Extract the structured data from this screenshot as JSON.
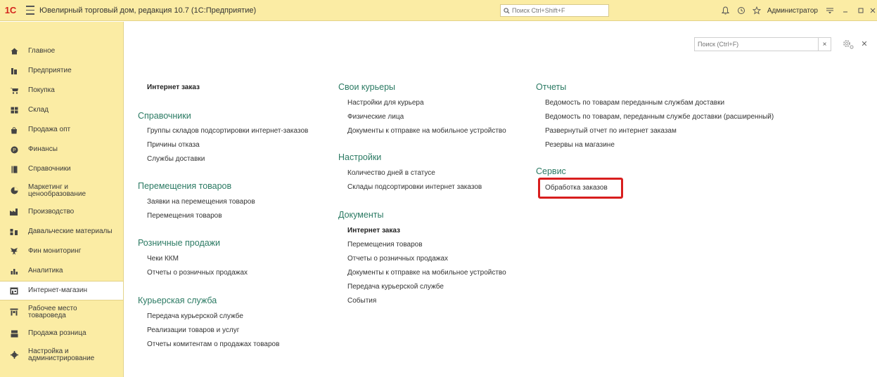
{
  "titlebar": {
    "logo": "1С",
    "title": "Ювелирный торговый дом, редакция 10.7  (1С:Предприятие)",
    "search_placeholder": "Поиск Ctrl+Shift+F",
    "user": "Администратор"
  },
  "sidebar": {
    "items": [
      {
        "label": "Главное"
      },
      {
        "label": "Предприятие"
      },
      {
        "label": "Покупка"
      },
      {
        "label": "Склад"
      },
      {
        "label": "Продажа опт"
      },
      {
        "label": "Финансы"
      },
      {
        "label": "Справочники"
      },
      {
        "label": "Маркетинг и ценообразование"
      },
      {
        "label": "Производство"
      },
      {
        "label": "Давальческие материалы"
      },
      {
        "label": "Фин мониторинг"
      },
      {
        "label": "Аналитика"
      },
      {
        "label": "Интернет-магазин"
      },
      {
        "label": "Рабочее место товароведа"
      },
      {
        "label": "Продажа розница"
      },
      {
        "label": "Настройка и администрирование"
      }
    ]
  },
  "content": {
    "search_placeholder": "Поиск (Ctrl+F)",
    "col1": {
      "top_link": "Интернет заказ",
      "sections": [
        {
          "title": "Справочники",
          "links": [
            "Группы складов подсортировки интернет-заказов",
            "Причины отказа",
            "Службы доставки"
          ]
        },
        {
          "title": "Перемещения товаров",
          "links": [
            "Заявки на перемещения товаров",
            "Перемещения товаров"
          ]
        },
        {
          "title": "Розничные продажи",
          "links": [
            "Чеки ККМ",
            "Отчеты о розничных продажах"
          ]
        },
        {
          "title": "Курьерская служба",
          "links": [
            "Передача курьерской службе",
            "Реализации товаров и услуг",
            "Отчеты комитентам о продажах товаров"
          ]
        }
      ]
    },
    "col2": {
      "sections": [
        {
          "title": "Свои курьеры",
          "links": [
            "Настройки для курьера",
            "Физические лица",
            "Документы к отправке на мобильное устройство"
          ]
        },
        {
          "title": "Настройки",
          "links": [
            "Количество дней в статусе",
            "Склады подсортировки интернет заказов"
          ]
        },
        {
          "title": "Документы",
          "links": [
            "Интернет заказ",
            "Перемещения товаров",
            "Отчеты о розничных продажах",
            "Документы к отправке на мобильное устройство",
            "Передача курьерской службе",
            "События"
          ]
        }
      ]
    },
    "col3": {
      "sections": [
        {
          "title": "Отчеты",
          "links": [
            "Ведомость по товарам переданным службам доставки",
            "Ведомость по товарам, переданным службе доставки (расширенный)",
            "Развернутый отчет по интернет заказам",
            "Резервы на магазине"
          ]
        },
        {
          "title": "Сервис",
          "links": [
            "Обработка заказов"
          ]
        }
      ]
    },
    "colors": {
      "section_title": "#2b7a63",
      "highlight": "#d81e1e",
      "panel": "#fbeca4"
    }
  }
}
